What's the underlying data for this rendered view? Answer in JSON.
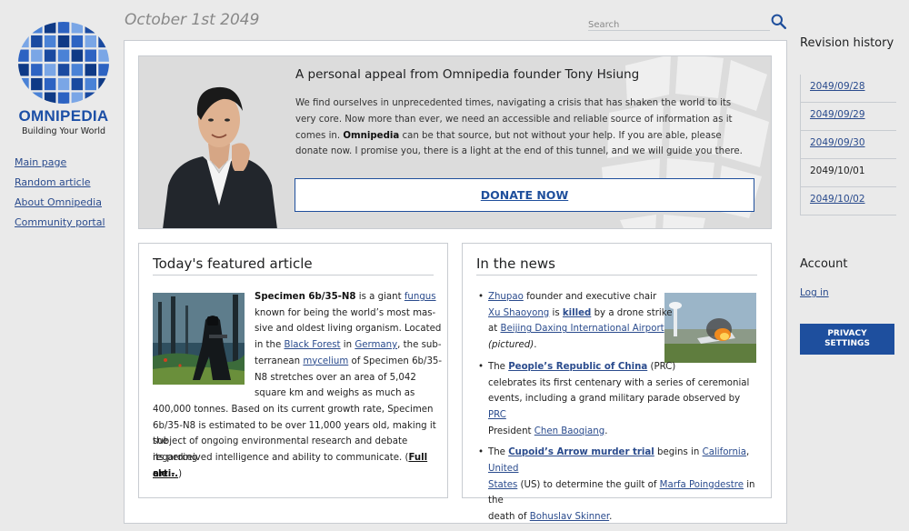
{
  "brand": {
    "name": "OMNIPEDIA",
    "tagline": "Building Your World",
    "primary_color": "#1c4fa6"
  },
  "header": {
    "date": "October 1st 2049",
    "search": {
      "placeholder": "Search",
      "value": "",
      "icon": "search-icon"
    }
  },
  "left_nav": {
    "items": [
      {
        "label": "Main page"
      },
      {
        "label": "Random article"
      },
      {
        "label": "About Omnipedia"
      },
      {
        "label": "Community portal"
      }
    ]
  },
  "appeal": {
    "title": "A personal appeal from Omnipedia founder Tony Hsiung",
    "body_1": "We find ourselves in unprecedented times, navigating a crisis that has shaken the world to its very core. Now more than ever, we need an accessible and reliable source of information as it comes in. ",
    "body_bold": "Omnipedia",
    "body_2": " can be that source, but not without your help. If you are able, please donate now. I promise you, there is a light at the end of this tunnel, and we will guide you there.",
    "donate_label": "DONATE NOW",
    "button_color": "#1f4f9c"
  },
  "featured": {
    "title": "Today's featured article",
    "line1_bold": "Specimen 6b/35-N8",
    "line1_a": " is a giant ",
    "line1_link": "fungus",
    "line2": "known for being the world’s most mas-",
    "line3": "sive and oldest living organism. Located",
    "line4_a": "in the ",
    "line4_link1": "Black Forest",
    "line4_b": " in ",
    "line4_link2": "Germany",
    "line4_c": ", the sub-",
    "line5_a": "terranean ",
    "line5_link": "mycelium",
    "line5_b": " of Specimen 6b/35-",
    "line6": "N8 stretches over an area of 5,042",
    "line7": "square km and weighs as much as",
    "line8": "400,000 tonnes. Based on its current growth rate, Specimen",
    "line9": "6b/35-N8 is estimated to be over 11,000 years old, making it the",
    "line10": "subject of ongoing environmental research and debate regarding",
    "line11_a": "its perceived intelligence and ability to communicate. (",
    "line11_link": "Full arti-",
    "line12_link": "cle...",
    "line12_b": ")"
  },
  "news": {
    "title": "In the news",
    "items": [
      {
        "l1_link": "Zhupao",
        "l1_b": " founder and executive chair",
        "l2_link": "Xu Shaoyong",
        "l2_b": " is ",
        "l2_bold": "killed",
        "l2_c": " by a drone strike",
        "l3_a": "at ",
        "l3_link": "Beijing Daxing International Airport",
        "l4_italic": "(pictured)",
        "l4_b": "."
      },
      {
        "l1_a": "The ",
        "l1_bold": "People’s Republic of China",
        "l1_b": " (PRC)",
        "l2": "celebrates its first centenary with a series of ceremonial",
        "l3_a": "events, including a grand military parade observed by ",
        "l3_link": "PRC",
        "l4_a": "President ",
        "l4_link": "Chen Baoqiang",
        "l4_b": "."
      },
      {
        "l1_a": "The ",
        "l1_bold": "Cupoid’s Arrow murder trial",
        "l1_b": " begins in ",
        "l1_link1": "California",
        "l1_c": ", ",
        "l1_link2": "United",
        "l2_link": "States",
        "l2_b": " (US) to determine the guilt of ",
        "l2_link2": "Marfa Poingdestre",
        "l2_c": " in the",
        "l3_a": "death of ",
        "l3_link": "Bohuslav Skinner",
        "l3_b": "."
      }
    ]
  },
  "revision_history": {
    "title": "Revision history",
    "items": [
      {
        "label": "2049/09/28",
        "current": false
      },
      {
        "label": "2049/09/29",
        "current": false
      },
      {
        "label": "2049/09/30",
        "current": false
      },
      {
        "label": "2049/10/01",
        "current": true
      },
      {
        "label": "2049/10/02",
        "current": false
      }
    ]
  },
  "account": {
    "title": "Account",
    "login_label": "Log in",
    "privacy_label_1": "PRIVACY",
    "privacy_label_2": "SETTINGS",
    "privacy_color": "#1e4f9e"
  }
}
